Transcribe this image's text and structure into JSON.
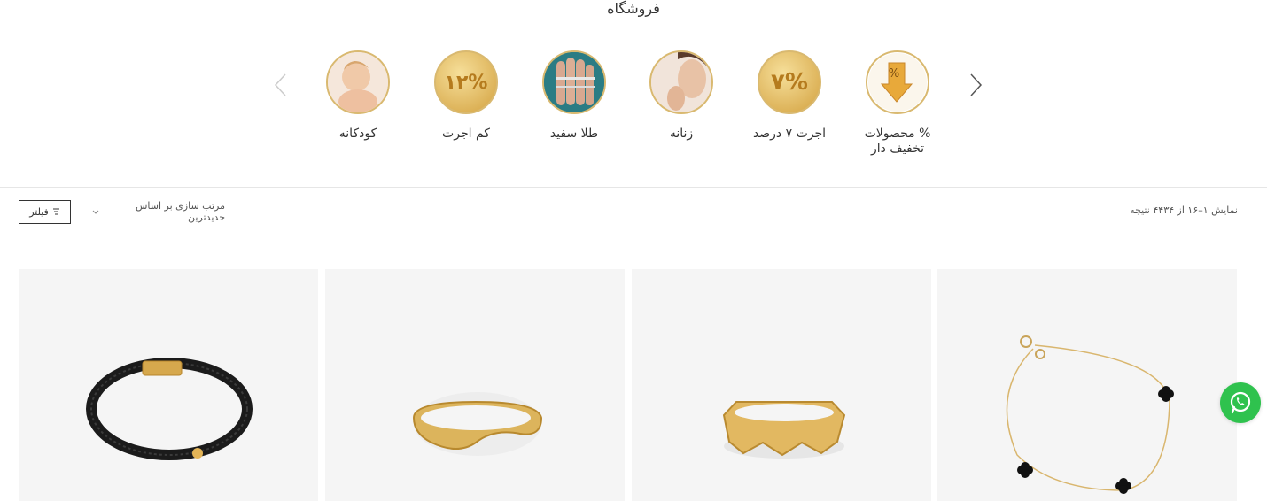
{
  "page": {
    "title": "فروشگاه"
  },
  "categories": [
    {
      "label": "% محصولات تخفیف دار",
      "icon": "discount-tag-icon"
    },
    {
      "label": "اجرت ۷ درصد",
      "icon": "percent-7-icon"
    },
    {
      "label": "زنانه",
      "icon": "women-model-icon"
    },
    {
      "label": "طلا سفید",
      "icon": "white-gold-rings-icon"
    },
    {
      "label": "کم اجرت",
      "icon": "percent-12-icon"
    },
    {
      "label": "کودکانه",
      "icon": "baby-photo-icon"
    }
  ],
  "category_badges": {
    "seven": "۷%",
    "twelve": "۱۲%"
  },
  "toolbar": {
    "result_count": "نمایش ۱–۱۶ از ۴۴۳۴ نتیجه",
    "sort_label": "مرتب سازی بر اساس جدیدترین",
    "filter_label": "فیلتر"
  },
  "products": [
    {
      "name": "bracelet-leather-black",
      "icon": "leather-bracelet-icon"
    },
    {
      "name": "wavy-gold-ring",
      "icon": "wavy-ring-icon"
    },
    {
      "name": "faceted-gold-ring",
      "icon": "faceted-ring-icon"
    },
    {
      "name": "clover-chain-bracelet",
      "icon": "clover-bracelet-icon"
    }
  ],
  "colors": {
    "gold": "#d9b06a",
    "whatsapp": "#2fc24e",
    "border": "#e6e6e6"
  }
}
